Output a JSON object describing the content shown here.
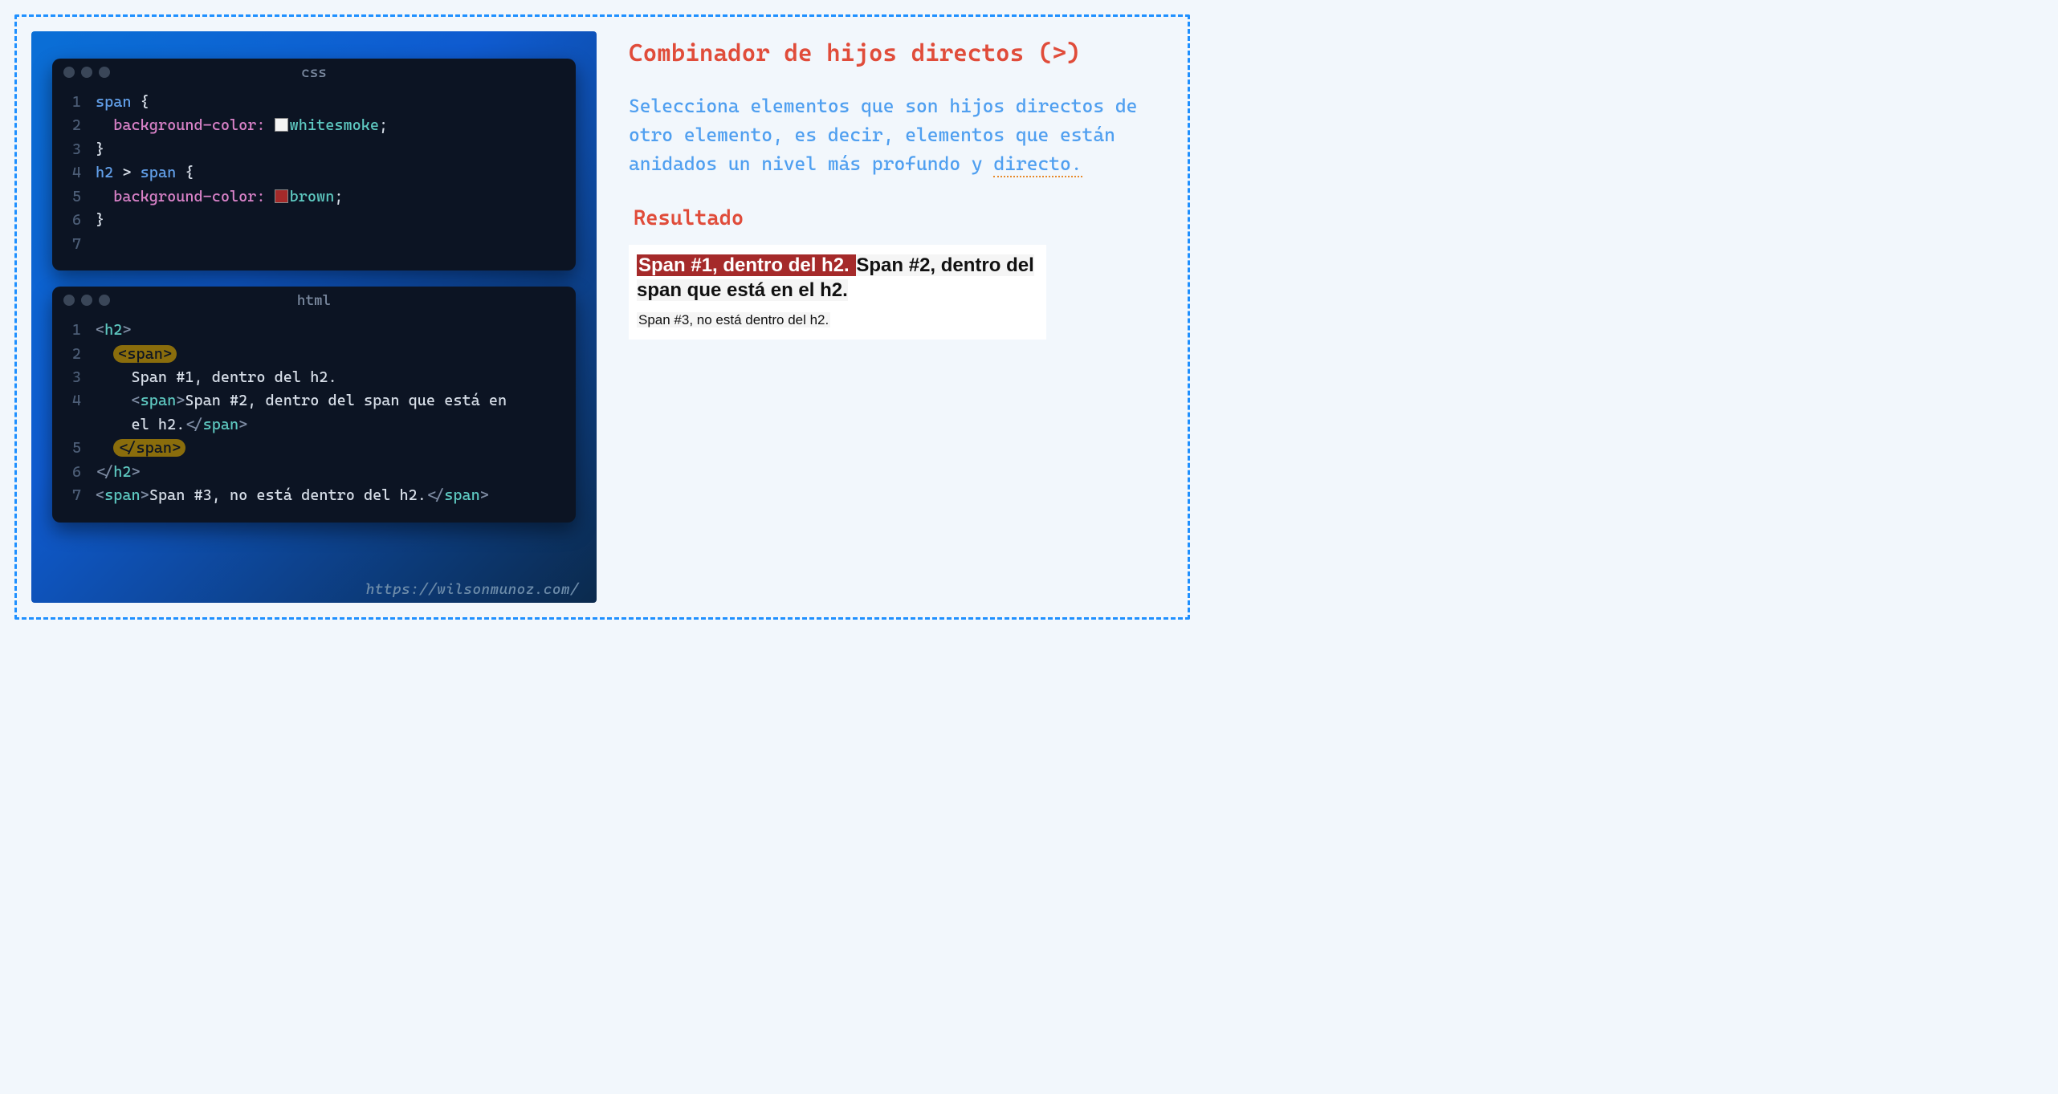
{
  "title": "Combinador de hijos directos (>)",
  "description_parts": {
    "before": "Selecciona elementos que son hijos directos de otro elemento, es decir, elementos que están anidados un nivel más profundo y ",
    "underlined": "directo."
  },
  "subtitle": "Resultado",
  "watermark": "https://wilsonmunoz.com/",
  "editor_css": {
    "title": "css",
    "lines": [
      {
        "n": "1",
        "segs": [
          {
            "t": "span ",
            "c": "tok-sel"
          },
          {
            "t": "{",
            "c": "tok-plain"
          }
        ]
      },
      {
        "n": "2",
        "segs": [
          {
            "t": "  ",
            "c": "tok-plain"
          },
          {
            "t": "background-color",
            "c": "tok-prop"
          },
          {
            "t": ": ",
            "c": "tok-colon"
          },
          {
            "swatch": "#f5f5f5"
          },
          {
            "t": "whitesmoke",
            "c": "tok-val"
          },
          {
            "t": ";",
            "c": "tok-plain"
          }
        ]
      },
      {
        "n": "3",
        "segs": [
          {
            "t": "}",
            "c": "tok-plain"
          }
        ]
      },
      {
        "n": "4",
        "segs": [
          {
            "t": "h2 ",
            "c": "tok-sel"
          },
          {
            "t": "> ",
            "c": "tok-plain"
          },
          {
            "t": "span ",
            "c": "tok-sel"
          },
          {
            "t": "{",
            "c": "tok-plain"
          }
        ]
      },
      {
        "n": "5",
        "segs": [
          {
            "t": "  ",
            "c": "tok-plain"
          },
          {
            "t": "background-color",
            "c": "tok-prop"
          },
          {
            "t": ": ",
            "c": "tok-colon"
          },
          {
            "swatch": "#a52a2a"
          },
          {
            "t": "brown",
            "c": "tok-val"
          },
          {
            "t": ";",
            "c": "tok-plain"
          }
        ]
      },
      {
        "n": "6",
        "segs": [
          {
            "t": "}",
            "c": "tok-plain"
          }
        ]
      },
      {
        "n": "7",
        "segs": [
          {
            "t": "",
            "c": "tok-plain"
          }
        ]
      }
    ]
  },
  "editor_html": {
    "title": "html",
    "lines": [
      {
        "n": "1",
        "segs": [
          {
            "t": "<",
            "c": "tok-punc"
          },
          {
            "t": "h2",
            "c": "tok-tag"
          },
          {
            "t": ">",
            "c": "tok-punc"
          }
        ]
      },
      {
        "n": "2",
        "segs": [
          {
            "t": "  ",
            "c": "tok-plain"
          },
          {
            "hl": true,
            "inner": [
              {
                "t": "<",
                "c": "tok-punc"
              },
              {
                "t": "span",
                "c": "tok-tag"
              },
              {
                "t": ">",
                "c": "tok-punc"
              }
            ]
          }
        ]
      },
      {
        "n": "3",
        "segs": [
          {
            "t": "    Span #1, dentro del h2.",
            "c": "tok-plain"
          }
        ]
      },
      {
        "n": "4",
        "segs": [
          {
            "t": "    ",
            "c": "tok-plain"
          },
          {
            "t": "<",
            "c": "tok-punc"
          },
          {
            "t": "span",
            "c": "tok-tag"
          },
          {
            "t": ">",
            "c": "tok-punc"
          },
          {
            "t": "Span #2, dentro del span que está en",
            "c": "tok-plain"
          }
        ]
      },
      {
        "n": "",
        "segs": [
          {
            "t": "    el h2.",
            "c": "tok-plain"
          },
          {
            "t": "</",
            "c": "tok-punc"
          },
          {
            "t": "span",
            "c": "tok-tag"
          },
          {
            "t": ">",
            "c": "tok-punc"
          }
        ]
      },
      {
        "n": "5",
        "segs": [
          {
            "t": "  ",
            "c": "tok-plain"
          },
          {
            "hl": true,
            "inner": [
              {
                "t": "</",
                "c": "tok-punc"
              },
              {
                "t": "span",
                "c": "tok-tag"
              },
              {
                "t": ">",
                "c": "tok-punc"
              }
            ]
          }
        ]
      },
      {
        "n": "6",
        "segs": [
          {
            "t": "</",
            "c": "tok-punc"
          },
          {
            "t": "h2",
            "c": "tok-tag"
          },
          {
            "t": ">",
            "c": "tok-punc"
          }
        ]
      },
      {
        "n": "7",
        "segs": [
          {
            "t": "<",
            "c": "tok-punc"
          },
          {
            "t": "span",
            "c": "tok-tag"
          },
          {
            "t": ">",
            "c": "tok-punc"
          },
          {
            "t": "Span #3, no está dentro del h2.",
            "c": "tok-plain"
          },
          {
            "t": "</",
            "c": "tok-punc"
          },
          {
            "t": "span",
            "c": "tok-tag"
          },
          {
            "t": ">",
            "c": "tok-punc"
          }
        ]
      }
    ]
  },
  "result": {
    "span1": "Span #1, dentro del h2. ",
    "span2": "Span #2, dentro del span que está en el h2.",
    "span3": "Span #3, no está dentro del h2."
  }
}
